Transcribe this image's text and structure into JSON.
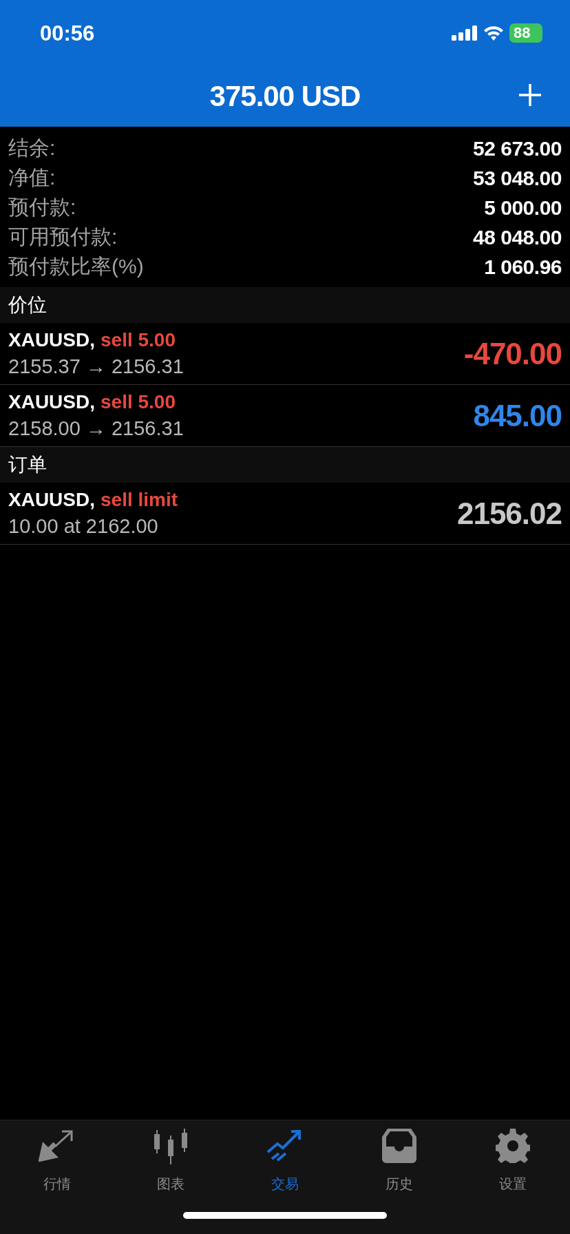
{
  "status_bar": {
    "time": "00:56",
    "battery": "88"
  },
  "header": {
    "title": "375.00 USD"
  },
  "summary": [
    {
      "label": "结余:",
      "value": "52 673.00"
    },
    {
      "label": "净值:",
      "value": "53 048.00"
    },
    {
      "label": "预付款:",
      "value": "5 000.00"
    },
    {
      "label": "可用预付款:",
      "value": "48 048.00"
    },
    {
      "label": "预付款比率(%)",
      "value": "1 060.96"
    }
  ],
  "sections": [
    {
      "title": "价位",
      "rows": [
        {
          "symbol": "XAUUSD,",
          "action": "sell 5.00",
          "detail": "2155.37 → 2156.31",
          "amount": "-470.00",
          "kind": "loss"
        },
        {
          "symbol": "XAUUSD,",
          "action": "sell 5.00",
          "detail": "2158.00 → 2156.31",
          "amount": "845.00",
          "kind": "profit"
        }
      ]
    },
    {
      "title": "订单",
      "rows": [
        {
          "symbol": "XAUUSD,",
          "action": "sell limit",
          "detail": "10.00 at 2162.00",
          "amount": "2156.02",
          "kind": "price"
        }
      ]
    }
  ],
  "tab_bar": [
    {
      "label": "行情",
      "selected": false
    },
    {
      "label": "图表",
      "selected": false
    },
    {
      "label": "交易",
      "selected": true
    },
    {
      "label": "历史",
      "selected": false
    },
    {
      "label": "设置",
      "selected": false
    }
  ]
}
